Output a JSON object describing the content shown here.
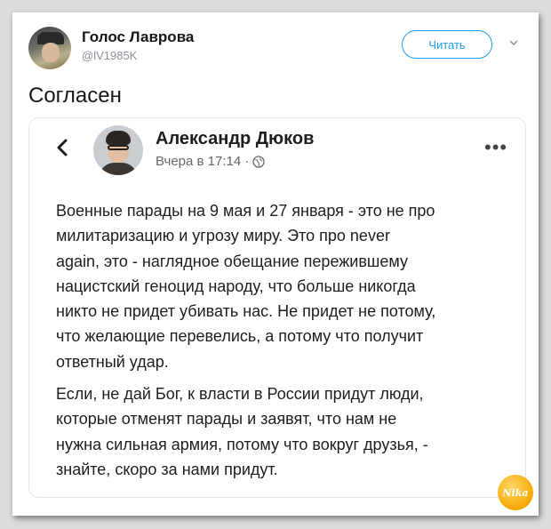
{
  "tweet": {
    "display_name": "Голос Лаврова",
    "handle": "@lV1985K",
    "follow_label": "Читать",
    "text": "Согласен"
  },
  "embedded_post": {
    "author": "Александр Дюков",
    "timestamp": "Вчера в 17:14 ·",
    "paragraph1": "Военные парады на 9 мая и 27 января - это не про\nмилитаризацию и угрозу миру. Это про never\nagain,  это - наглядное обещание пережившему\nнацистский геноцид народу, что больше никогда\nникто не придет убивать нас. Не придет не потому,\nчто желающие перевелись, а потому что получит\nответный удар.",
    "paragraph2": "Если, не дай Бог, к власти в России придут люди,\nкоторые отменят парады и заявят, что нам не\nнужна сильная армия, потому что вокруг друзья, -\nзнайте, скоро за нами придут."
  },
  "icons": {
    "back": "chevron-left-icon",
    "more": "more-icon",
    "audience": "globe-icon",
    "menu": "chevron-down-icon"
  },
  "colors": {
    "twitter_blue": "#1da1f2",
    "watermark": "#f6a800"
  }
}
